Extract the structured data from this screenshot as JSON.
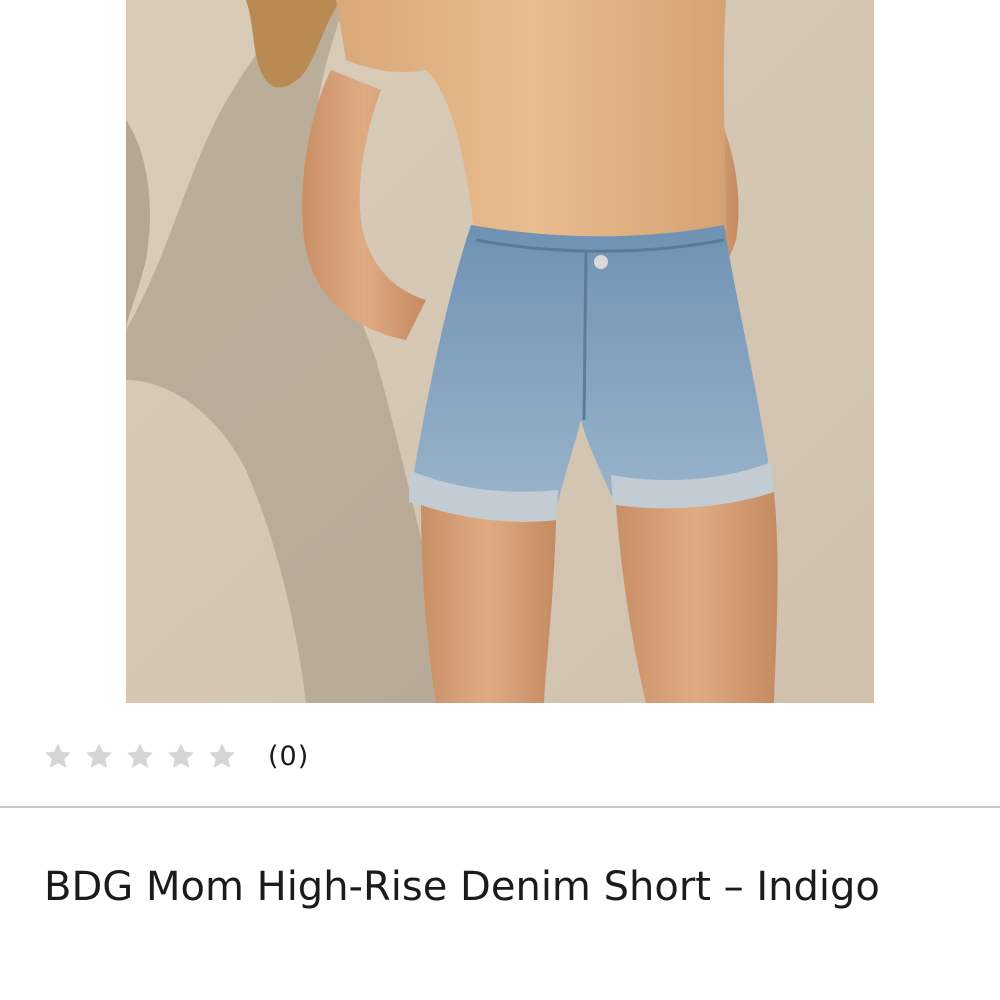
{
  "product": {
    "image_alt": "BDG Mom High-Rise Denim Short – Indigo",
    "rating": {
      "stars_filled": 0,
      "stars_total": 5,
      "review_count_label": "(0)",
      "star_empty_color": "#d6d6d6"
    },
    "title": "BDG Mom High-Rise Denim Short – Indigo"
  },
  "colors": {
    "divider": "#c9c9c9",
    "text": "#1b1b1b"
  }
}
